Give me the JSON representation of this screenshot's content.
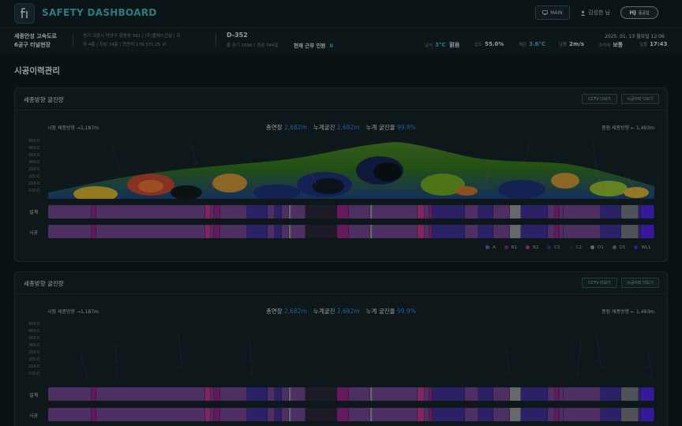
{
  "header": {
    "title": "SAFETY DASHBOARD",
    "main_label": "MAIN",
    "user_name": "김성한 님",
    "brand": "HJ",
    "brand_sub": "중공업"
  },
  "site": {
    "name_line1": "세종안성 고속도로",
    "name_line2": "6공구 터널현장",
    "address_line1": "경기 고양시 덕양구 향동동 391 | (주)플렉스건설 | 지",
    "address_line2": "하 4층 | 지상 34층 | 연면적 179,371.25 ㎡",
    "code": "D-352",
    "code_stats": "총 공기 1096 / 경과 744일",
    "workers_label": "현재 근무 인원",
    "workers_value": "0",
    "datetime": "2025. 01. 13 월요일 12:06"
  },
  "weather": [
    {
      "label": "날씨",
      "value": "3°C",
      "extra": "맑음"
    },
    {
      "label": "습도",
      "value": "55.0%"
    },
    {
      "label": "체감",
      "value": "3.6°C"
    },
    {
      "label": "남풍",
      "value": "2m/s"
    },
    {
      "label": "초미세",
      "value": "보통"
    },
    {
      "label": "일몰",
      "value": "17:43"
    }
  ],
  "page_title": "시공이력관리",
  "panels": [
    {
      "title": "세종방향 굴진량",
      "cctv_label": "CCTV 더보기",
      "history_label": "시공이력 더보기",
      "start_label": "시점 세종방향 →1,187m",
      "end_label": "종점 세종방향 ← 1,493m",
      "total_label": "총연장",
      "total_value": "2,682m",
      "cum_label": "누계굴진",
      "cum_value": "2,682m",
      "rate_label": "누계 굴진율",
      "rate_value": "99.9%",
      "design_label": "설계",
      "build_label": "시공"
    },
    {
      "title": "세종방향 굴진량",
      "cctv_label": "CCTV 더보기",
      "history_label": "시공이력 더보기",
      "start_label": "시점 세종방향 →1,187m",
      "end_label": "종점 세종방향 ← 1,493m",
      "total_label": "총연장",
      "total_value": "2,682m",
      "cum_label": "누계굴진",
      "cum_value": "2,682m",
      "rate_label": "누계 굴진율",
      "rate_value": "99.9%",
      "design_label": "설계",
      "build_label": "시공"
    }
  ],
  "y_ticks": [
    "450.0",
    "400.0",
    "350.0",
    "300.0",
    "250.0",
    "200.0",
    "150.0",
    "100.0"
  ],
  "legend": [
    {
      "label": "A",
      "color": "#7b4a9b"
    },
    {
      "label": "B1",
      "color": "#8a1f7a"
    },
    {
      "label": "B2",
      "color": "#b0307f"
    },
    {
      "label": "C1",
      "color": "#3a2a8a"
    },
    {
      "label": "C2",
      "color": "#262232"
    },
    {
      "label": "D1",
      "color": "#8c8c94"
    },
    {
      "label": "D1",
      "color": "#6e6e78"
    },
    {
      "label": "WL1",
      "color": "#4a1fd0"
    }
  ],
  "strip_segments": [
    {
      "w": 7.3,
      "c": "#6a3d86"
    },
    {
      "w": 0.8,
      "c": "#8a1f7a"
    },
    {
      "w": 18.4,
      "c": "#6a3d86"
    },
    {
      "w": 1.0,
      "c": "#b0307f"
    },
    {
      "w": 0.5,
      "c": "#6a3d86"
    },
    {
      "w": 1.0,
      "c": "#8a1f7a"
    },
    {
      "w": 4.6,
      "c": "#6a3d86"
    },
    {
      "w": 3.5,
      "c": "#3a2a8a"
    },
    {
      "w": 1.2,
      "c": "#6a3d86"
    },
    {
      "w": 1.2,
      "c": "#3a2a8a"
    },
    {
      "w": 1.1,
      "c": "#6a3d86"
    },
    {
      "w": 0.4,
      "c": "#8c8c94"
    },
    {
      "w": 2.5,
      "c": "#6a3d86"
    },
    {
      "w": 5.3,
      "c": "#262232"
    },
    {
      "w": 1.9,
      "c": "#8a1f7a"
    },
    {
      "w": 3.7,
      "c": "#6a3d86"
    },
    {
      "w": 0.4,
      "c": "#8c8c94"
    },
    {
      "w": 7.5,
      "c": "#6a3d86"
    },
    {
      "w": 1.3,
      "c": "#b0307f"
    },
    {
      "w": 0.7,
      "c": "#6a3d86"
    },
    {
      "w": 0.6,
      "c": "#8a1f7a"
    },
    {
      "w": 5.5,
      "c": "#3a2a8a"
    },
    {
      "w": 2.2,
      "c": "#6a3d86"
    },
    {
      "w": 2.6,
      "c": "#3a2a8a"
    },
    {
      "w": 2.8,
      "c": "#6a3d86"
    },
    {
      "w": 1.8,
      "c": "#8c8c94"
    },
    {
      "w": 4.5,
      "c": "#3a2a8a"
    },
    {
      "w": 1.2,
      "c": "#6a3d86"
    },
    {
      "w": 0.9,
      "c": "#8a1f7a"
    },
    {
      "w": 0.6,
      "c": "#6a3d86"
    },
    {
      "w": 6.3,
      "c": "#6a3d86"
    },
    {
      "w": 3.5,
      "c": "#3a2a8a"
    },
    {
      "w": 2.8,
      "c": "#6e6e78"
    },
    {
      "w": 0.5,
      "c": "#3a2a8a"
    },
    {
      "w": 2.2,
      "c": "#4a1fd0"
    }
  ]
}
